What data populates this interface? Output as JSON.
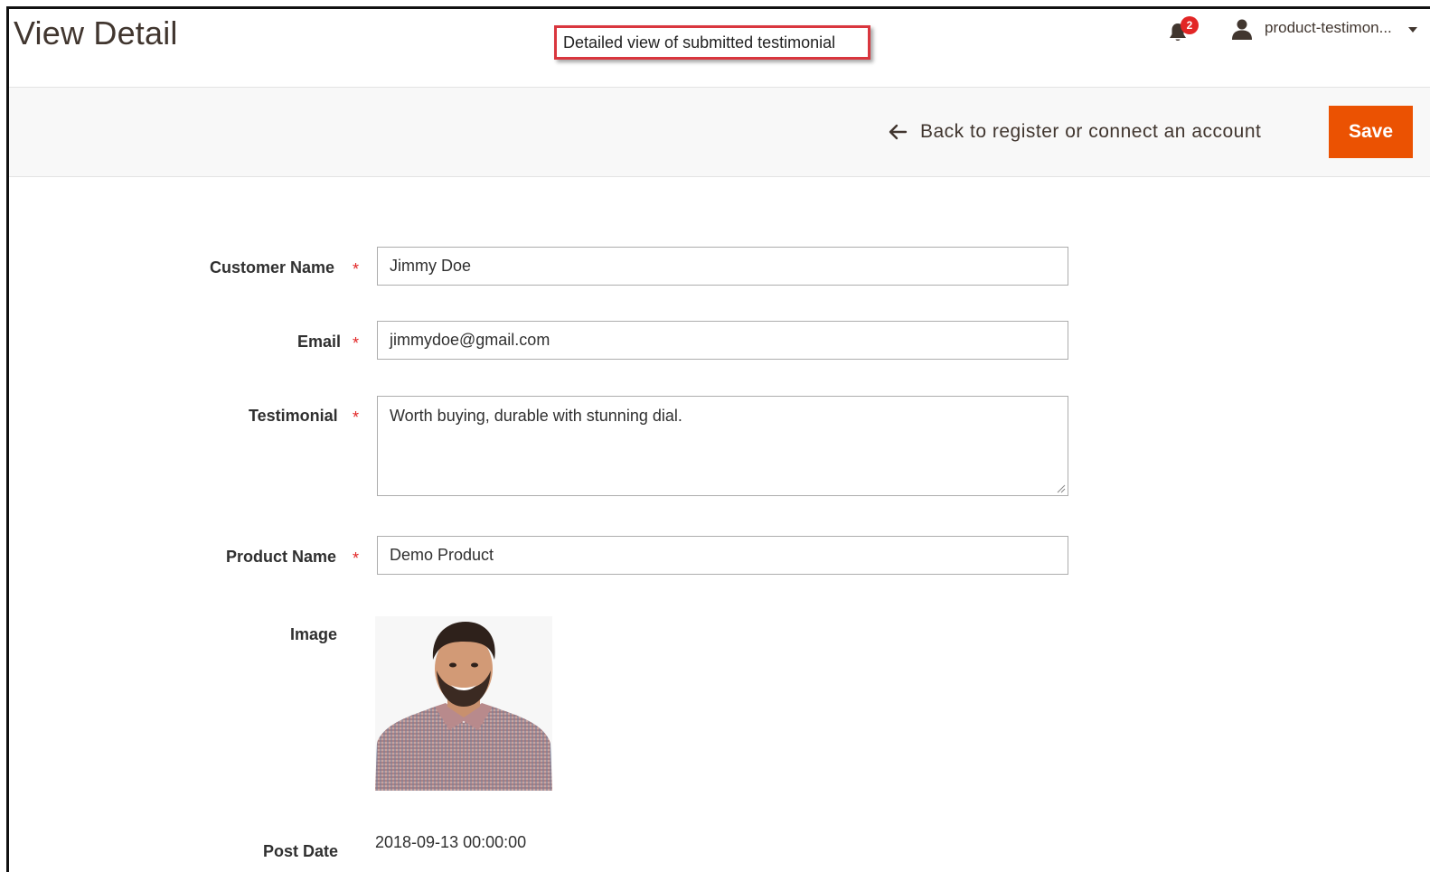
{
  "header": {
    "title": "View Detail",
    "callout": "Detailed view of submitted testimonial",
    "notifications_count": "2",
    "user_name": "product-testimon..."
  },
  "actions": {
    "back_label": "Back to register or connect an account",
    "save_label": "Save"
  },
  "form": {
    "customer_name": {
      "label": "Customer Name",
      "required": "*",
      "value": "Jimmy Doe"
    },
    "email": {
      "label": "Email",
      "required": "*",
      "value": "jimmydoe@gmail.com"
    },
    "testimonial": {
      "label": "Testimonial",
      "required": "*",
      "value": "Worth buying, durable with stunning dial."
    },
    "product_name": {
      "label": "Product Name",
      "required": "*",
      "value": "Demo Product"
    },
    "image": {
      "label": "Image"
    },
    "post_date": {
      "label": "Post Date",
      "value": "2018-09-13 00:00:00"
    }
  },
  "colors": {
    "accent": "#eb5202",
    "required": "#e22626",
    "callout_border": "#d9363e",
    "badge": "#e22626"
  },
  "icons": {
    "notifications": "bell-icon",
    "user": "user-icon",
    "dropdown": "caret-down-icon",
    "back": "arrow-left-icon"
  }
}
